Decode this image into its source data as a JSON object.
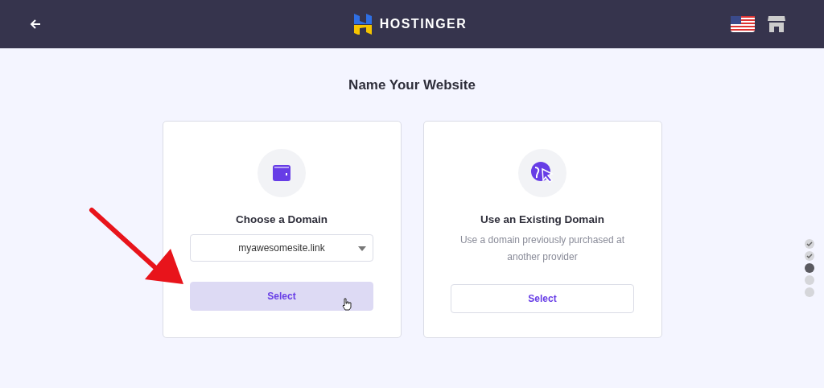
{
  "header": {
    "brand": "HOSTINGER"
  },
  "title": "Name Your Website",
  "cards": [
    {
      "kind": "dropdown",
      "heading": "Choose a Domain",
      "dropdown": {
        "value": "myawesomesite.link"
      },
      "button": {
        "label": "Select",
        "hovered": true
      }
    },
    {
      "kind": "description",
      "heading": "Use an Existing Domain",
      "description": "Use a domain previously purchased at another provider",
      "button": {
        "label": "Select",
        "hovered": false
      }
    }
  ],
  "steps": [
    {
      "checked": true,
      "selected": false
    },
    {
      "checked": true,
      "selected": false
    },
    {
      "checked": false,
      "selected": true
    },
    {
      "checked": false,
      "selected": false
    },
    {
      "checked": false,
      "selected": false
    }
  ]
}
